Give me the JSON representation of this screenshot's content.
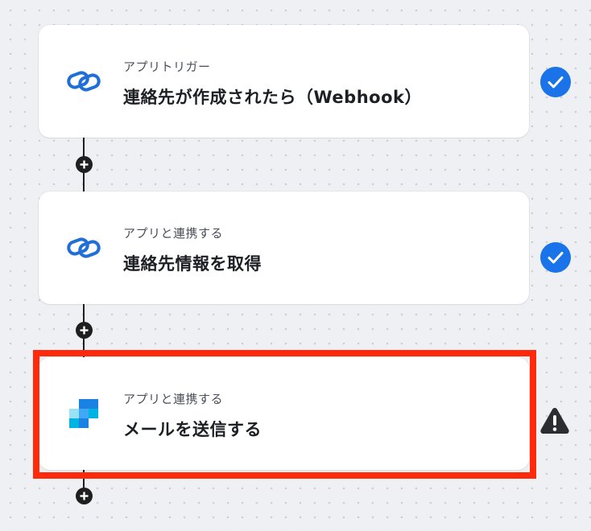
{
  "flow": {
    "steps": [
      {
        "kind": "trigger",
        "subtitle": "アプリトリガー",
        "title": "連絡先が作成されたら（Webhook）",
        "icon": "zoho-chain-icon",
        "status": "complete"
      },
      {
        "kind": "action",
        "subtitle": "アプリと連携する",
        "title": "連絡先情報を取得",
        "icon": "zoho-chain-icon",
        "status": "complete"
      },
      {
        "kind": "action",
        "subtitle": "アプリと連携する",
        "title": "メールを送信する",
        "icon": "sendgrid-icon",
        "status": "warning"
      }
    ],
    "add_step_icon": "plus-icon"
  },
  "colors": {
    "status_complete": "#1a73e8",
    "status_warning": "#2b2d31",
    "highlight": "#ff2a0c",
    "chain_icon": "#1f6fd6",
    "connector": "#1f1f1f"
  }
}
